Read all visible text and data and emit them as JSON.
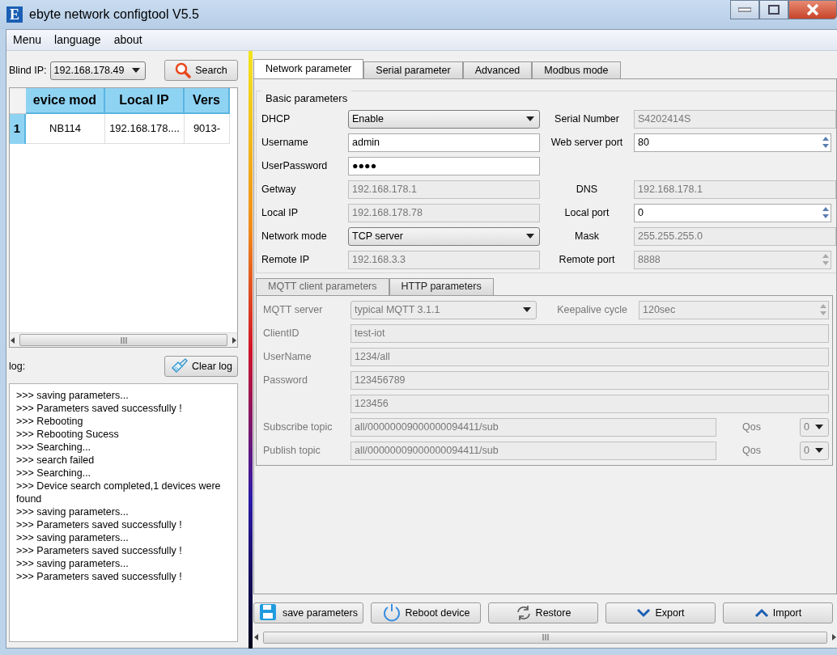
{
  "window": {
    "logo_text": "E",
    "title": "ebyte network configtool V5.5"
  },
  "menu": [
    "Menu",
    "language",
    "about"
  ],
  "blind_ip": {
    "label": "Blind IP:",
    "value": "192.168.178.49"
  },
  "search_button": {
    "label": "Search"
  },
  "device_table": {
    "columns": [
      "evice mod",
      "Local IP",
      "Vers"
    ],
    "rows": [
      {
        "row_header": "1",
        "cells": [
          "NB114",
          "192.168.178....",
          "9013-"
        ]
      }
    ]
  },
  "log": {
    "label": "log:",
    "clear_button": "Clear log",
    "lines": [
      ">>> saving parameters...",
      ">>> Parameters saved successfully !",
      ">>> Rebooting",
      ">>> Rebooting Sucess",
      ">>> Searching...",
      ">>> search failed",
      ">>> Searching...",
      ">>> Device search completed,1 devices were found",
      ">>> saving parameters...",
      ">>> Parameters saved successfully !",
      ">>> saving parameters...",
      ">>> Parameters saved successfully !",
      ">>> saving parameters...",
      ">>> Parameters saved successfully !"
    ]
  },
  "tabs": [
    {
      "label": "Network parameter",
      "selected": true
    },
    {
      "label": "Serial parameter",
      "selected": false
    },
    {
      "label": "Advanced",
      "selected": false
    },
    {
      "label": "Modbus mode",
      "selected": false
    }
  ],
  "basic_parameters": {
    "title": "Basic parameters",
    "rows": [
      {
        "label": "DHCP",
        "field": {
          "kind": "select",
          "value": "Enable",
          "disabled": false
        },
        "label_2": "Serial Number",
        "field_2": {
          "kind": "text",
          "value": "S4202414S",
          "disabled": true
        }
      },
      {
        "label": "Username",
        "field": {
          "kind": "text",
          "value": "admin",
          "disabled": false
        },
        "label_2": "Web server port",
        "field_2": {
          "kind": "spin",
          "value": "80",
          "disabled": false
        }
      },
      {
        "label": "UserPassword",
        "field": {
          "kind": "text",
          "value": "●●●●",
          "disabled": false
        }
      },
      {
        "label": "Getway",
        "field": {
          "kind": "text",
          "value": "192.168.178.1",
          "disabled": true
        },
        "label_2": "DNS",
        "field_2": {
          "kind": "text",
          "value": "192.168.178.1",
          "disabled": true
        }
      },
      {
        "label": "Local IP",
        "field": {
          "kind": "text",
          "value": "192.168.178.78",
          "disabled": true
        },
        "label_2": "Local port",
        "field_2": {
          "kind": "spin",
          "value": "0",
          "disabled": false
        }
      },
      {
        "label": "Network mode",
        "field": {
          "kind": "select",
          "value": "TCP server",
          "disabled": false
        },
        "label_2": "Mask",
        "field_2": {
          "kind": "text",
          "value": "255.255.255.0",
          "disabled": true
        }
      },
      {
        "label": "Remote IP",
        "field": {
          "kind": "text",
          "value": "192.168.3.3",
          "disabled": true
        },
        "label_2": "Remote port",
        "field_2": {
          "kind": "spin",
          "value": "8888",
          "disabled": true
        }
      }
    ]
  },
  "sub_tabs": [
    {
      "label": "MQTT client parameters",
      "selected": true
    },
    {
      "label": "HTTP parameters",
      "selected": false
    }
  ],
  "mqtt": {
    "disabled": true,
    "rows": [
      {
        "label": "MQTT server",
        "field": {
          "kind": "select",
          "value": "typical MQTT 3.1.1",
          "disabled": true
        },
        "label_2": "Keepalive cycle",
        "field_2": {
          "kind": "spin",
          "value": "120sec",
          "disabled": true
        }
      },
      {
        "label": "ClientID",
        "field": {
          "kind": "text",
          "value": "test-iot",
          "disabled": true
        }
      },
      {
        "label": "UserName",
        "field": {
          "kind": "text",
          "value": "1234/all",
          "disabled": true
        }
      },
      {
        "label": "Password",
        "field": {
          "kind": "text",
          "value": "123456789",
          "disabled": true
        }
      },
      {
        "field": {
          "kind": "text",
          "value": "123456",
          "disabled": true
        }
      },
      {
        "label": "Subscribe topic",
        "field": {
          "kind": "text",
          "value": "all/00000009000000094411/sub",
          "disabled": true
        },
        "label_2": "Qos",
        "field_2": {
          "kind": "select",
          "value": "0",
          "disabled": true
        }
      },
      {
        "label": "Publish topic",
        "field": {
          "kind": "text",
          "value": "all/00000009000000094411/sub",
          "disabled": true
        },
        "label_2": "Qos",
        "field_2": {
          "kind": "select",
          "value": "0",
          "disabled": true
        }
      }
    ]
  },
  "actions": [
    {
      "kind": "save",
      "label": "save parameters"
    },
    {
      "kind": "reboot",
      "label": "Reboot device"
    },
    {
      "kind": "restore",
      "label": "Restore"
    },
    {
      "kind": "export",
      "label": "Export"
    },
    {
      "kind": "import",
      "label": "Import"
    }
  ]
}
